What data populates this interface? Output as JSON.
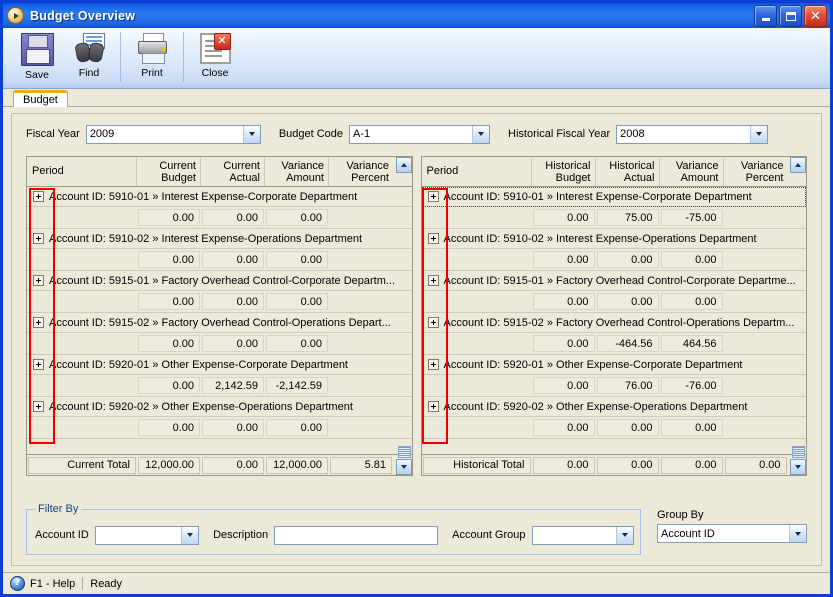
{
  "window": {
    "title": "Budget Overview",
    "icon": "app-play-icon",
    "controls": {
      "minimize": "Minimize",
      "maximize": "Maximize",
      "close": "Close"
    },
    "border_color": "#0a3fd4"
  },
  "toolbar": {
    "items": [
      {
        "label": "Save",
        "icon": "save-floppy-icon"
      },
      {
        "label": "Find",
        "icon": "binoculars-icon"
      },
      {
        "label": "Print",
        "icon": "printer-icon"
      },
      {
        "label": "Close",
        "icon": "close-document-icon"
      }
    ]
  },
  "tabs": [
    {
      "label": "Budget",
      "active": true
    }
  ],
  "filters": {
    "fiscal_year": {
      "label": "Fiscal Year",
      "value": "2009"
    },
    "budget_code": {
      "label": "Budget Code",
      "value": "A-1"
    },
    "historical_fiscal_year": {
      "label": "Historical Fiscal Year",
      "value": "2008"
    }
  },
  "left_grid": {
    "name": "current-budget-grid",
    "columns": [
      "Period",
      "Current\nBudget",
      "Current\nActual",
      "Variance\nAmount",
      "Variance\nPercent"
    ],
    "rows": [
      {
        "header": "Account ID: 5910-01 » Interest Expense-Corporate Department",
        "values": [
          "0.00",
          "0.00",
          "0.00",
          ""
        ]
      },
      {
        "header": "Account ID: 5910-02 » Interest Expense-Operations Department",
        "values": [
          "0.00",
          "0.00",
          "0.00",
          ""
        ]
      },
      {
        "header": "Account ID: 5915-01 » Factory Overhead Control-Corporate Departm...",
        "values": [
          "0.00",
          "0.00",
          "0.00",
          ""
        ]
      },
      {
        "header": "Account ID: 5915-02 » Factory Overhead Control-Operations Depart...",
        "values": [
          "0.00",
          "0.00",
          "0.00",
          ""
        ]
      },
      {
        "header": "Account ID: 5920-01 » Other Expense-Corporate Department",
        "values": [
          "0.00",
          "2,142.59",
          "-2,142.59",
          ""
        ]
      },
      {
        "header": "Account ID: 5920-02 » Other Expense-Operations Department",
        "values": [
          "0.00",
          "0.00",
          "0.00",
          ""
        ]
      }
    ],
    "total": {
      "label": "Current Total",
      "values": [
        "12,000.00",
        "0.00",
        "12,000.00",
        "5.81"
      ]
    }
  },
  "right_grid": {
    "name": "historical-budget-grid",
    "columns": [
      "Period",
      "Historical\nBudget",
      "Historical\nActual",
      "Variance\nAmount",
      "Variance\nPercent"
    ],
    "rows": [
      {
        "header": "Account ID: 5910-01 » Interest Expense-Corporate Department",
        "values": [
          "0.00",
          "75.00",
          "-75.00",
          ""
        ],
        "focused": true
      },
      {
        "header": "Account ID: 5910-02 » Interest Expense-Operations Department",
        "values": [
          "0.00",
          "0.00",
          "0.00",
          ""
        ]
      },
      {
        "header": "Account ID: 5915-01 » Factory Overhead Control-Corporate Departme...",
        "values": [
          "0.00",
          "0.00",
          "0.00",
          ""
        ]
      },
      {
        "header": "Account ID: 5915-02 » Factory Overhead Control-Operations Departm...",
        "values": [
          "0.00",
          "-464.56",
          "464.56",
          ""
        ]
      },
      {
        "header": "Account ID: 5920-01 » Other Expense-Corporate Department",
        "values": [
          "0.00",
          "76.00",
          "-76.00",
          ""
        ]
      },
      {
        "header": "Account ID: 5920-02 » Other Expense-Operations Department",
        "values": [
          "0.00",
          "0.00",
          "0.00",
          ""
        ]
      }
    ],
    "total": {
      "label": "Historical Total",
      "values": [
        "0.00",
        "0.00",
        "0.00",
        "0.00"
      ]
    }
  },
  "filter_by": {
    "legend": "Filter By",
    "account_id": {
      "label": "Account ID",
      "value": "",
      "placeholder": ""
    },
    "description": {
      "label": "Description",
      "value": "",
      "placeholder": ""
    },
    "account_group": {
      "label": "Account Group",
      "value": "",
      "placeholder": ""
    }
  },
  "group_by": {
    "label": "Group By",
    "value": "Account ID"
  },
  "statusbar": {
    "help": "F1 - Help",
    "status": "Ready",
    "icon": "help-question-icon"
  },
  "annotation": {
    "color": "#ee0000",
    "shape": "rectangle",
    "count": 2
  }
}
